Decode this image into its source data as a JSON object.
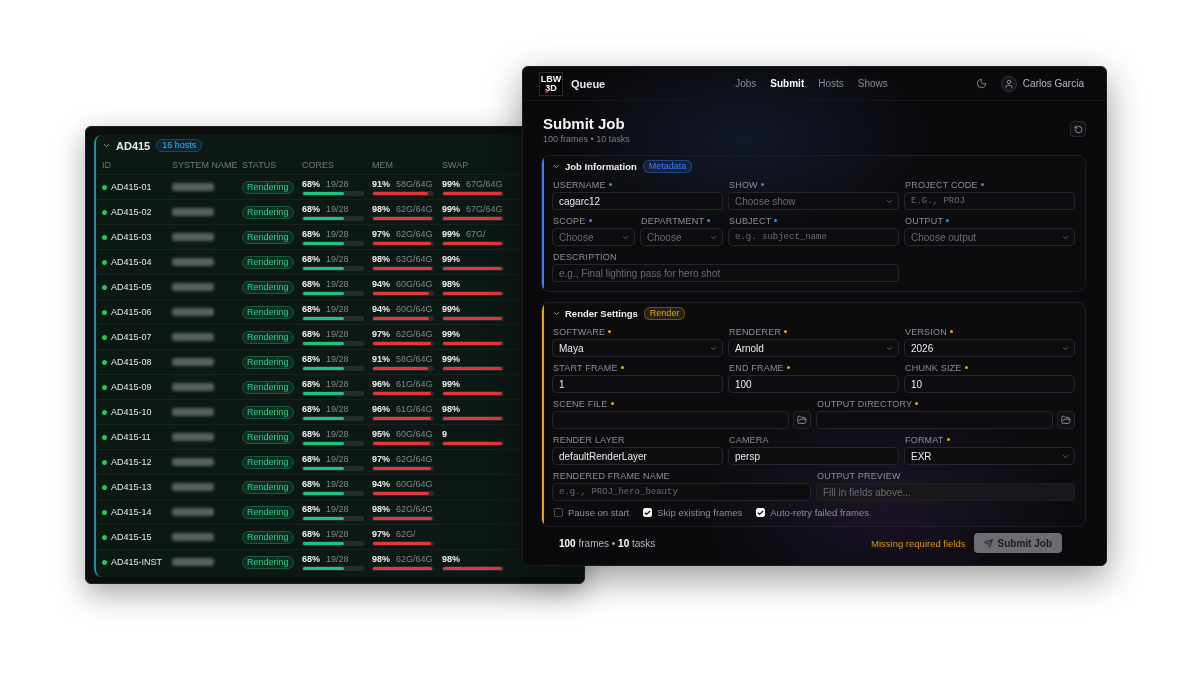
{
  "hosts_window": {
    "group": {
      "name": "AD415",
      "badge": "16 hosts",
      "expanded": true
    },
    "columns": [
      "ID",
      "SYSTEM NAME",
      "STATUS",
      "CORES",
      "MEM",
      "SWAP"
    ],
    "rows": [
      {
        "id": "AD415-01",
        "online": true,
        "status": "Rendering",
        "cores": {
          "percent": "68%",
          "value": "19/28",
          "level": 0.68
        },
        "mem": {
          "percent": "91%",
          "value": "58G/64G",
          "level": 0.91
        },
        "swap": {
          "percent": "99%",
          "value": "67G/64G",
          "level": 0.99
        }
      },
      {
        "id": "AD415-02",
        "online": true,
        "status": "Rendering",
        "cores": {
          "percent": "68%",
          "value": "19/28",
          "level": 0.68
        },
        "mem": {
          "percent": "98%",
          "value": "62G/64G",
          "level": 0.98
        },
        "swap": {
          "percent": "99%",
          "value": "67G/64G",
          "level": 0.99
        }
      },
      {
        "id": "AD415-03",
        "online": true,
        "status": "Rendering",
        "cores": {
          "percent": "68%",
          "value": "19/28",
          "level": 0.68
        },
        "mem": {
          "percent": "97%",
          "value": "62G/64G",
          "level": 0.97
        },
        "swap": {
          "percent": "99%",
          "value": "67G/",
          "level": 0.99
        }
      },
      {
        "id": "AD415-04",
        "online": true,
        "status": "Rendering",
        "cores": {
          "percent": "68%",
          "value": "19/28",
          "level": 0.68
        },
        "mem": {
          "percent": "98%",
          "value": "63G/64G",
          "level": 0.98
        },
        "swap": {
          "percent": "99%",
          "level": 0.99
        }
      },
      {
        "id": "AD415-05",
        "online": true,
        "status": "Rendering",
        "cores": {
          "percent": "68%",
          "value": "19/28",
          "level": 0.68
        },
        "mem": {
          "percent": "94%",
          "value": "60G/64G",
          "level": 0.94
        },
        "swap": {
          "percent": "98%",
          "level": 0.98
        }
      },
      {
        "id": "AD415-06",
        "online": true,
        "status": "Rendering",
        "cores": {
          "percent": "68%",
          "value": "19/28",
          "level": 0.68
        },
        "mem": {
          "percent": "94%",
          "value": "60G/64G",
          "level": 0.94
        },
        "swap": {
          "percent": "99%",
          "level": 0.99
        }
      },
      {
        "id": "AD415-07",
        "online": true,
        "status": "Rendering",
        "cores": {
          "percent": "68%",
          "value": "19/28",
          "level": 0.68
        },
        "mem": {
          "percent": "97%",
          "value": "62G/64G",
          "level": 0.97
        },
        "swap": {
          "percent": "99%",
          "level": 0.99
        }
      },
      {
        "id": "AD415-08",
        "online": true,
        "status": "Rendering",
        "cores": {
          "percent": "68%",
          "value": "19/28",
          "level": 0.68
        },
        "mem": {
          "percent": "91%",
          "value": "58G/64G",
          "level": 0.91
        },
        "swap": {
          "percent": "99%",
          "level": 0.99
        }
      },
      {
        "id": "AD415-09",
        "online": true,
        "status": "Rendering",
        "cores": {
          "percent": "68%",
          "value": "19/28",
          "level": 0.68
        },
        "mem": {
          "percent": "96%",
          "value": "61G/64G",
          "level": 0.96
        },
        "swap": {
          "percent": "99%",
          "level": 0.99
        }
      },
      {
        "id": "AD415-10",
        "online": true,
        "status": "Rendering",
        "cores": {
          "percent": "68%",
          "value": "19/28",
          "level": 0.68
        },
        "mem": {
          "percent": "96%",
          "value": "61G/64G",
          "level": 0.96
        },
        "swap": {
          "percent": "98%",
          "level": 0.98
        }
      },
      {
        "id": "AD415-11",
        "online": true,
        "status": "Rendering",
        "cores": {
          "percent": "68%",
          "value": "19/28",
          "level": 0.68
        },
        "mem": {
          "percent": "95%",
          "value": "60G/64G",
          "level": 0.95
        },
        "swap": {
          "percent": "9",
          "level": 0.99
        }
      },
      {
        "id": "AD415-12",
        "online": true,
        "status": "Rendering",
        "cores": {
          "percent": "68%",
          "value": "19/28",
          "level": 0.68
        },
        "mem": {
          "percent": "97%",
          "value": "62G/64G",
          "level": 0.97
        }
      },
      {
        "id": "AD415-13",
        "online": true,
        "status": "Rendering",
        "cores": {
          "percent": "68%",
          "value": "19/28",
          "level": 0.68
        },
        "mem": {
          "percent": "94%",
          "value": "60G/64G",
          "level": 0.94
        }
      },
      {
        "id": "AD415-14",
        "online": true,
        "status": "Rendering",
        "cores": {
          "percent": "68%",
          "value": "19/28",
          "level": 0.68
        },
        "mem": {
          "percent": "98%",
          "value": "62G/64G",
          "level": 0.98
        }
      },
      {
        "id": "AD415-15",
        "online": true,
        "status": "Rendering",
        "cores": {
          "percent": "68%",
          "value": "19/28",
          "level": 0.68
        },
        "mem": {
          "percent": "97%",
          "value": "62G/",
          "level": 0.97
        }
      },
      {
        "id": "AD415-INST",
        "online": true,
        "status": "Rendering",
        "cores": {
          "percent": "68%",
          "value": "19/28",
          "level": 0.68
        },
        "mem": {
          "percent": "98%",
          "value": "62G/64G",
          "level": 0.98
        },
        "swap": {
          "percent": "98%",
          "level": 0.98
        }
      }
    ]
  },
  "submit_window": {
    "logo": [
      "LBW",
      "3D"
    ],
    "app_name": "Queue",
    "nav": [
      {
        "label": "Jobs",
        "selected": false
      },
      {
        "label": "Submit",
        "selected": true
      },
      {
        "label": "Hosts",
        "selected": false
      },
      {
        "label": "Shows",
        "selected": false
      }
    ],
    "user": {
      "name": "Carlos Garcia"
    },
    "title": "Submit Job",
    "subtitle": "100 frames • 10 tasks",
    "sections": [
      {
        "title": "Job Information",
        "badge": "Metadata",
        "color": "#3b82f6",
        "expanded": true,
        "rows": [
          {
            "fields": [
              {
                "kind": "text",
                "label": "USERNAME",
                "required": true,
                "value": "cagarc12"
              },
              {
                "kind": "select",
                "label": "SHOW",
                "required": true,
                "placeholder": "Choose show"
              },
              {
                "kind": "code",
                "label": "PROJECT CODE",
                "required": true,
                "placeholder": "E.G., PROJ"
              }
            ]
          },
          {
            "fields": [
              {
                "kind": "select",
                "label": "SCOPE",
                "required": true,
                "placeholder": "Choose"
              },
              {
                "kind": "select",
                "label": "DEPARTMENT",
                "required": true,
                "placeholder": "Choose"
              },
              {
                "kind": "code",
                "label": "SUBJECT",
                "required": true,
                "placeholder": "e.g. subject_name"
              },
              {
                "kind": "select",
                "label": "OUTPUT",
                "required": true,
                "placeholder": "Choose output"
              }
            ]
          },
          {
            "fields": [
              {
                "kind": "text",
                "label": "DESCRIPTION",
                "required": false,
                "placeholder": "e.g., Final lighting pass for hero shot"
              }
            ]
          }
        ]
      },
      {
        "title": "Render Settings",
        "badge": "Render",
        "color": "#e0a31a",
        "expanded": true,
        "rows": [
          {
            "fields": [
              {
                "kind": "select",
                "label": "SOFTWARE",
                "required": true,
                "value": "Maya"
              },
              {
                "kind": "select",
                "label": "RENDERER",
                "required": true,
                "value": "Arnold"
              },
              {
                "kind": "select",
                "label": "VERSION",
                "required": true,
                "value": "2026"
              }
            ]
          },
          {
            "fields": [
              {
                "kind": "text",
                "label": "START FRAME",
                "required": true,
                "value": "1"
              },
              {
                "kind": "text",
                "label": "END FRAME",
                "required": true,
                "value": "100"
              },
              {
                "kind": "text",
                "label": "CHUNK SIZE",
                "required": true,
                "value": "10"
              }
            ]
          },
          {
            "fields": [
              {
                "kind": "path",
                "label": "SCENE FILE",
                "required": true
              },
              {
                "kind": "path",
                "label": "OUTPUT DIRECTORY",
                "required": true
              }
            ]
          },
          {
            "fields": [
              {
                "kind": "text",
                "label": "RENDER LAYER",
                "required": false,
                "value": "defaultRenderLayer"
              },
              {
                "kind": "text",
                "label": "CAMERA",
                "required": false,
                "value": "persp"
              },
              {
                "kind": "select",
                "label": "FORMAT",
                "required": true,
                "value": "EXR"
              }
            ]
          },
          {
            "fields": [
              {
                "kind": "code",
                "label": "RENDERED FRAME NAME",
                "required": false,
                "placeholder": "e.g., PROJ_hero_beauty"
              },
              {
                "kind": "preview",
                "label": "OUTPUT PREVIEW",
                "required": false,
                "placeholder": "Fill in fields above..."
              }
            ]
          }
        ],
        "options": [
          {
            "label": "Pause on start",
            "checked": false
          },
          {
            "label": "Skip existing frames",
            "checked": true
          },
          {
            "label": "Auto-retry failed frames",
            "checked": true
          }
        ]
      }
    ],
    "footer": {
      "summary": "**100** frames • **10** tasks",
      "warning": "Missing required fields",
      "submit": {
        "label": "Submit Job",
        "disabled": true
      }
    }
  }
}
